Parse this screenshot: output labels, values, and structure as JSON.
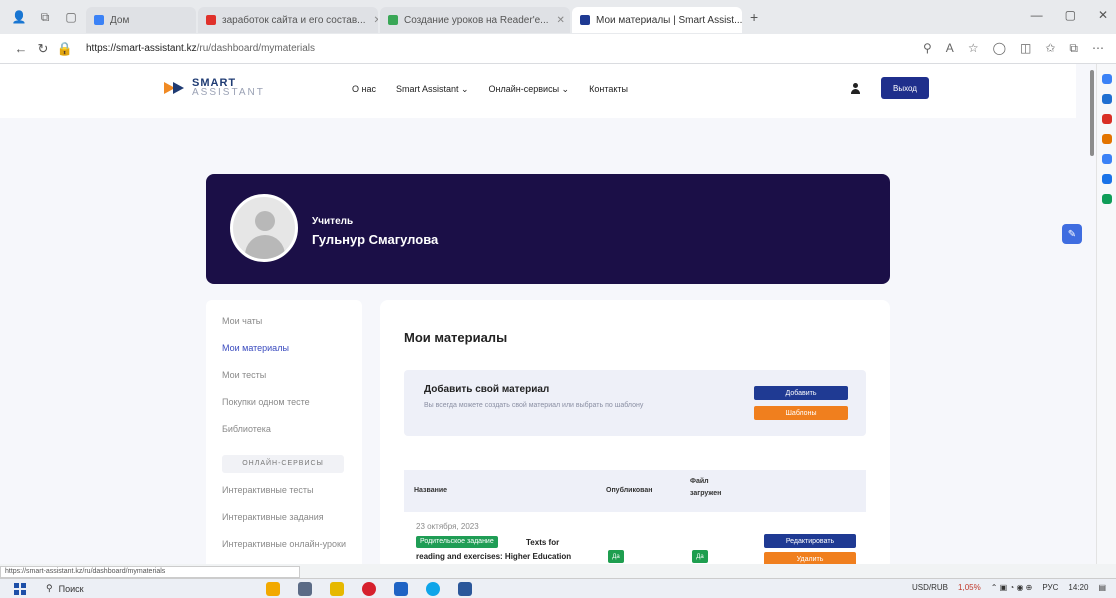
{
  "browser": {
    "tabs": [
      {
        "label": "Дом",
        "active": false,
        "color": "#3b82f6"
      },
      {
        "label": "заработок сайта и его состав...",
        "active": false,
        "color": "#e0312b"
      },
      {
        "label": "Создание уроков на Reader'е...",
        "active": false,
        "color": "#3aa757"
      },
      {
        "label": "Мои материалы | Smart Assist...",
        "active": true,
        "color": "#1f3a93"
      }
    ],
    "url_host": "https://smart-assistant.kz",
    "url_path": "/ru/dashboard/mymaterials",
    "new_tab": "+"
  },
  "site": {
    "logo_line1": "SMART",
    "logo_line2": "ASSISTANT",
    "nav": [
      "О нас",
      "Smart Assistant ⌄",
      "Онлайн-сервисы ⌄",
      "Контакты"
    ],
    "logout_label": "Выход"
  },
  "profile": {
    "role": "Учитель",
    "name": "Гульнур Смагулова"
  },
  "menu": {
    "items": [
      "Мои чаты",
      "Мои материалы",
      "Мои тесты",
      "Покупки одном тесте",
      "Библиотека"
    ],
    "active_index": 1,
    "section_label": "ОНЛАЙН-СЕРВИСЫ",
    "services": [
      "Интерактивные тесты",
      "Интерактивные задания",
      "Интерактивные онлайн-уроки"
    ]
  },
  "content": {
    "title": "Мои материалы",
    "add_title": "Добавить свой материал",
    "add_desc": "Вы всегда можете создать свой материал или выбрать по шаблону",
    "add_button": "Добавить",
    "template_button": "Шаблоны",
    "columns": {
      "name": "Название",
      "published": "Опубликован",
      "file_line1": "Файл",
      "file_line2": "загружен"
    },
    "row": {
      "date": "23 октября, 2023",
      "tag": "Родительское задание",
      "title": "Texts for reading and exercises: Higher Education in Great Britain and USA",
      "published": "Да",
      "file": "Да",
      "edit_button": "Редактировать",
      "delete_button": "Удалить"
    }
  },
  "status_url": "https://smart-assistant.kz/ru/dashboard/mymaterials",
  "taskbar": {
    "search_label": "Поиск",
    "currency": "USD/RUB",
    "change": "1,05%",
    "time": "14:20",
    "lang": "РУС"
  }
}
